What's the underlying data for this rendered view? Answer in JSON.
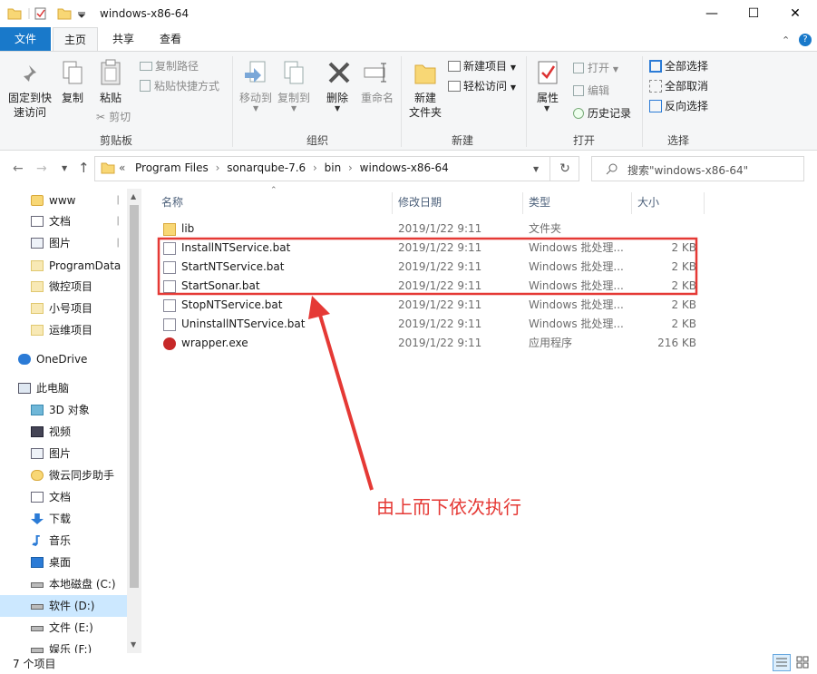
{
  "window": {
    "title": "windows-x86-64"
  },
  "ribbon_tabs": {
    "file": "文件",
    "home": "主页",
    "share": "共享",
    "view": "查看"
  },
  "ribbon": {
    "clipboard": {
      "label": "剪贴板",
      "pin": "固定到快\n速访问",
      "pin1": "固定到快",
      "pin2": "速访问",
      "copy": "复制",
      "paste": "粘贴",
      "copy_path": "复制路径",
      "paste_shortcut": "粘贴快捷方式",
      "cut": "剪切"
    },
    "organize": {
      "label": "组织",
      "move_to": "移动到",
      "copy_to": "复制到",
      "delete": "删除",
      "rename": "重命名"
    },
    "new": {
      "label": "新建",
      "new_folder1": "新建",
      "new_folder2": "文件夹",
      "new_item": "新建项目",
      "easy_access": "轻松访问"
    },
    "open": {
      "label": "打开",
      "properties": "属性",
      "open": "打开",
      "edit": "编辑",
      "history": "历史记录"
    },
    "select": {
      "label": "选择",
      "select_all": "全部选择",
      "select_none": "全部取消",
      "invert": "反向选择"
    }
  },
  "address": {
    "crumbs": [
      "Program Files",
      "sonarqube-7.6",
      "bin",
      "windows-x86-64"
    ],
    "prefix": "«",
    "search_placeholder": "搜索\"windows-x86-64\""
  },
  "nav": {
    "items": [
      {
        "label": "www",
        "pinned": true
      },
      {
        "label": "文档",
        "pinned": true
      },
      {
        "label": "图片",
        "pinned": true
      },
      {
        "label": "ProgramData"
      },
      {
        "label": "微控项目"
      },
      {
        "label": "小号项目"
      },
      {
        "label": "运维项目"
      },
      {
        "label": "OneDrive"
      },
      {
        "label": "此电脑"
      },
      {
        "label": "3D 对象"
      },
      {
        "label": "视频"
      },
      {
        "label": "图片"
      },
      {
        "label": "微云同步助手"
      },
      {
        "label": "文档"
      },
      {
        "label": "下载"
      },
      {
        "label": "音乐"
      },
      {
        "label": "桌面"
      },
      {
        "label": "本地磁盘 (C:)"
      },
      {
        "label": "软件 (D:)"
      },
      {
        "label": "文件 (E:)"
      },
      {
        "label": "娱乐 (F:)"
      }
    ]
  },
  "columns": {
    "name": "名称",
    "date": "修改日期",
    "type": "类型",
    "size": "大小"
  },
  "files": [
    {
      "name": "lib",
      "date": "2019/1/22 9:11",
      "type": "文件夹",
      "size": ""
    },
    {
      "name": "InstallNTService.bat",
      "date": "2019/1/22 9:11",
      "type": "Windows 批处理...",
      "size": "2 KB"
    },
    {
      "name": "StartNTService.bat",
      "date": "2019/1/22 9:11",
      "type": "Windows 批处理...",
      "size": "2 KB"
    },
    {
      "name": "StartSonar.bat",
      "date": "2019/1/22 9:11",
      "type": "Windows 批处理...",
      "size": "2 KB"
    },
    {
      "name": "StopNTService.bat",
      "date": "2019/1/22 9:11",
      "type": "Windows 批处理...",
      "size": "2 KB"
    },
    {
      "name": "UninstallNTService.bat",
      "date": "2019/1/22 9:11",
      "type": "Windows 批处理...",
      "size": "2 KB"
    },
    {
      "name": "wrapper.exe",
      "date": "2019/1/22 9:11",
      "type": "应用程序",
      "size": "216 KB"
    }
  ],
  "status": {
    "count": "7 个项目"
  },
  "annotation": {
    "text": "由上而下依次执行",
    "color": "#e53935"
  },
  "colors": {
    "accent": "#1979ca",
    "selected": "#cce8ff",
    "folder": "#f8d775"
  }
}
